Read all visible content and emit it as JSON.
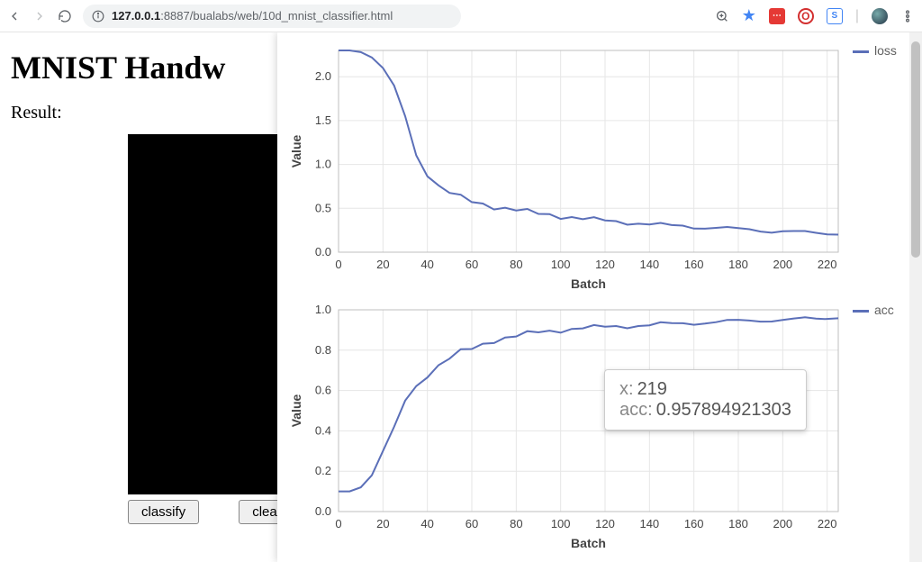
{
  "browser": {
    "host": "127.0.0.1",
    "port": ":8887",
    "path": "/bualabs/web/10d_mnist_classifier.html"
  },
  "page": {
    "title_visible": "MNIST Handw",
    "result_label": "Result:",
    "buttons": {
      "classify": "classify",
      "clear": "clear"
    }
  },
  "tooltip": {
    "x_label": "x:",
    "x_value": "219",
    "series_label": "acc:",
    "series_value": "0.957894921303"
  },
  "chart_data": [
    {
      "type": "line",
      "title": "",
      "xlabel": "Batch",
      "ylabel": "Value",
      "xlim": [
        0,
        225
      ],
      "ylim": [
        0.0,
        2.3
      ],
      "xticks": [
        0,
        20,
        40,
        60,
        80,
        100,
        120,
        140,
        160,
        180,
        200,
        220
      ],
      "yticks": [
        0.0,
        0.5,
        1.0,
        1.5,
        2.0
      ],
      "legend": "loss",
      "series": [
        {
          "name": "loss",
          "x": [
            0,
            5,
            10,
            15,
            20,
            25,
            30,
            35,
            40,
            45,
            50,
            55,
            60,
            65,
            70,
            75,
            80,
            85,
            90,
            95,
            100,
            105,
            110,
            115,
            120,
            125,
            130,
            135,
            140,
            145,
            150,
            155,
            160,
            165,
            170,
            175,
            180,
            185,
            190,
            195,
            200,
            205,
            210,
            215,
            220,
            225
          ],
          "values": [
            2.3,
            2.3,
            2.28,
            2.22,
            2.1,
            1.9,
            1.55,
            1.1,
            0.9,
            0.75,
            0.68,
            0.62,
            0.58,
            0.55,
            0.52,
            0.5,
            0.48,
            0.46,
            0.44,
            0.43,
            0.41,
            0.4,
            0.38,
            0.37,
            0.36,
            0.35,
            0.34,
            0.33,
            0.32,
            0.31,
            0.3,
            0.3,
            0.29,
            0.28,
            0.28,
            0.27,
            0.26,
            0.26,
            0.25,
            0.24,
            0.24,
            0.23,
            0.22,
            0.22,
            0.21,
            0.2
          ]
        }
      ]
    },
    {
      "type": "line",
      "title": "",
      "xlabel": "Batch",
      "ylabel": "Value",
      "xlim": [
        0,
        225
      ],
      "ylim": [
        0.0,
        1.0
      ],
      "xticks": [
        0,
        20,
        40,
        60,
        80,
        100,
        120,
        140,
        160,
        180,
        200,
        220
      ],
      "yticks": [
        0.0,
        0.2,
        0.4,
        0.6,
        0.8,
        1.0
      ],
      "legend": "acc",
      "series": [
        {
          "name": "acc",
          "x": [
            0,
            5,
            10,
            15,
            20,
            25,
            30,
            35,
            40,
            45,
            50,
            55,
            60,
            65,
            70,
            75,
            80,
            85,
            90,
            95,
            100,
            105,
            110,
            115,
            120,
            125,
            130,
            135,
            140,
            145,
            150,
            155,
            160,
            165,
            170,
            175,
            180,
            185,
            190,
            195,
            200,
            205,
            210,
            215,
            219,
            225
          ],
          "values": [
            0.1,
            0.1,
            0.12,
            0.18,
            0.3,
            0.42,
            0.55,
            0.62,
            0.68,
            0.72,
            0.76,
            0.79,
            0.81,
            0.83,
            0.85,
            0.86,
            0.87,
            0.88,
            0.89,
            0.895,
            0.9,
            0.905,
            0.91,
            0.912,
            0.915,
            0.918,
            0.92,
            0.922,
            0.925,
            0.928,
            0.93,
            0.932,
            0.935,
            0.937,
            0.94,
            0.942,
            0.944,
            0.946,
            0.948,
            0.95,
            0.95,
            0.952,
            0.954,
            0.956,
            0.9579,
            0.958
          ]
        }
      ]
    }
  ],
  "colors": {
    "line": "#5b6fb8",
    "grid": "#e6e6e6",
    "axis": "#bfbfbf",
    "text": "#606060"
  }
}
